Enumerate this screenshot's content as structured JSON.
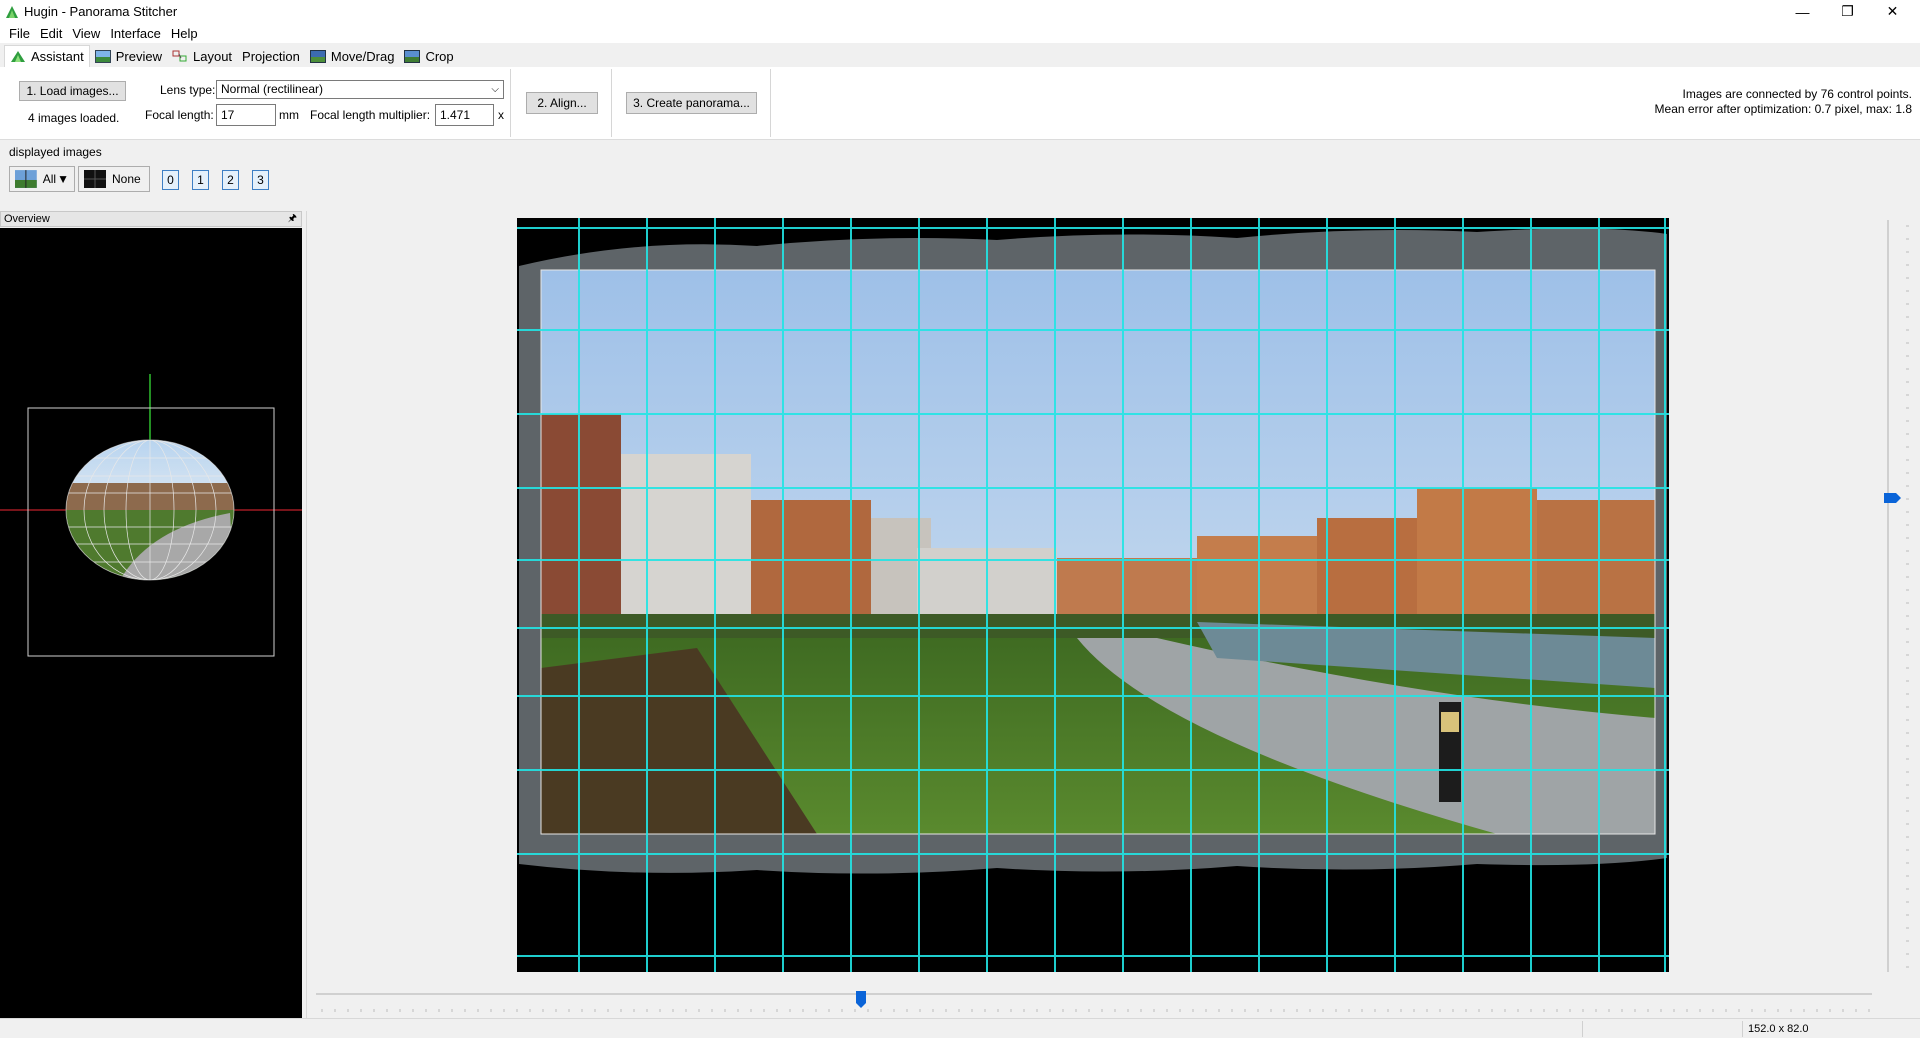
{
  "window": {
    "title": "Hugin - Panorama Stitcher",
    "minimize": "—",
    "restore": "❐",
    "close": "✕"
  },
  "menu": [
    "File",
    "Edit",
    "View",
    "Interface",
    "Help"
  ],
  "tabs": [
    {
      "label": "Assistant",
      "icon": "assistant-icon",
      "active": true
    },
    {
      "label": "Preview",
      "icon": "preview-icon",
      "active": false
    },
    {
      "label": "Layout",
      "icon": "layout-icon",
      "active": false
    },
    {
      "label": "Projection",
      "icon": "",
      "active": false
    },
    {
      "label": "Move/Drag",
      "icon": "move-drag-icon",
      "active": false
    },
    {
      "label": "Crop",
      "icon": "crop-icon",
      "active": false
    }
  ],
  "assistant": {
    "load_button": "1. Load images...",
    "images_loaded": "4 images loaded.",
    "lens_type_label": "Lens type:",
    "lens_type_value": "Normal (rectilinear)",
    "focal_length_label": "Focal length:",
    "focal_length_value": "17",
    "focal_length_unit": "mm",
    "multiplier_label": "Focal length multiplier:",
    "multiplier_value": "1.471",
    "multiplier_unit": "x",
    "align_button": "2. Align...",
    "create_button": "3. Create panorama...",
    "status_line1": "Images are connected by 76 control points.",
    "status_line2": "Mean error after optimization: 0.7 pixel, max: 1.8"
  },
  "displayed_images": {
    "label": "displayed images",
    "all_button": "All",
    "none_button": "None",
    "image_buttons": [
      "0",
      "1",
      "2",
      "3"
    ]
  },
  "overview": {
    "title": "Overview",
    "pin": "🖈"
  },
  "preview": {
    "grid_color": "#22e5e5",
    "hslider_value_fraction": 0.35,
    "vslider_value_fraction": 0.37
  },
  "statusbar": {
    "dimensions": "152.0 x 82.0"
  },
  "colors": {
    "accent": "#0a64d8",
    "grid": "#22e5e5"
  }
}
